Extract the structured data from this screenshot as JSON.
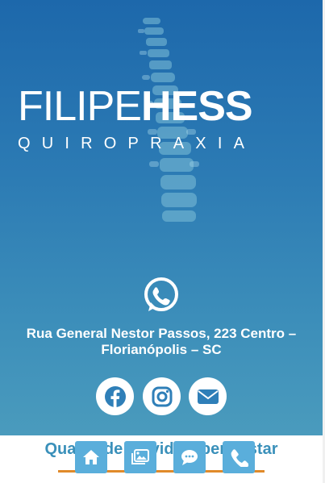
{
  "hero": {
    "logo_first": "FILIPE",
    "logo_last": "HESS",
    "logo_subtitle": "QUIROPRAXIA",
    "address_line1": "Rua General Nestor Passos, 223 Centro –",
    "address_line2": "Florianópolis – SC",
    "whatsapp_icon": "whatsapp-icon"
  },
  "social": [
    {
      "icon": "facebook-icon"
    },
    {
      "icon": "instagram-icon"
    },
    {
      "icon": "envelope-icon"
    }
  ],
  "bottom": {
    "heading": "Qualidade de vida e bem-estar"
  },
  "nav": [
    {
      "icon": "home-icon"
    },
    {
      "icon": "images-icon"
    },
    {
      "icon": "chat-icon"
    },
    {
      "icon": "phone-icon"
    }
  ],
  "colors": {
    "hero_top": "#1d68ab",
    "hero_bottom": "#4a9bbd",
    "accent_blue": "#3a90ba",
    "nav_button": "#5aaedb",
    "underline_orange": "#e08a2a"
  }
}
